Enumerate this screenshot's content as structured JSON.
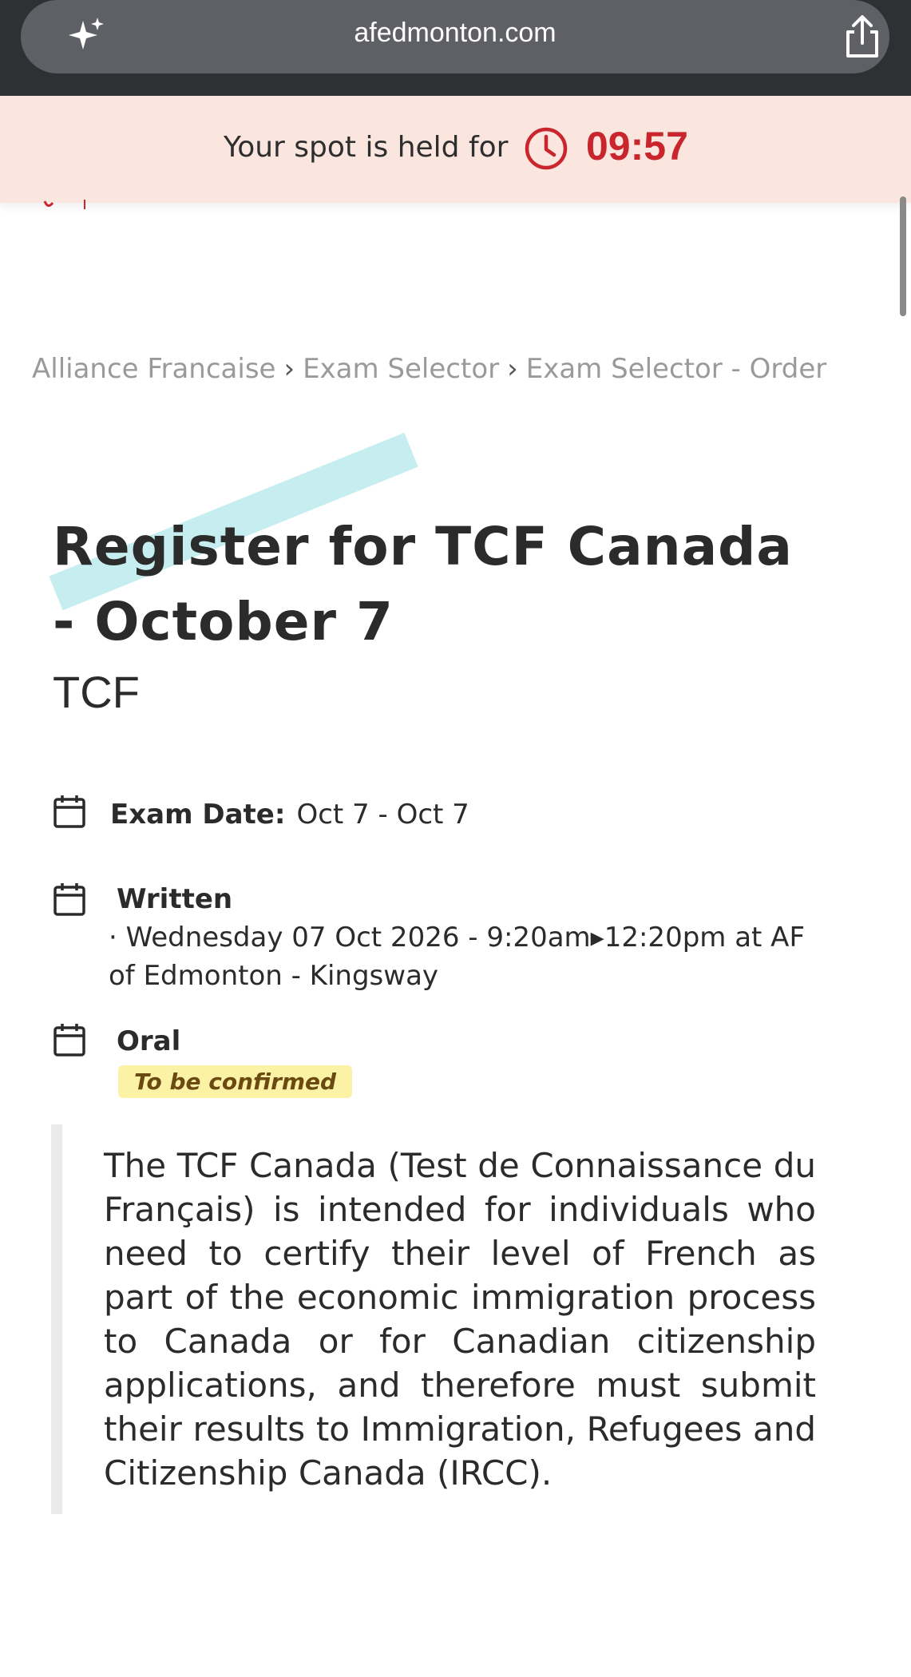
{
  "browser": {
    "url": "afedmonton.com",
    "left_icon": "sparkle-icon",
    "right_icon": "share-icon"
  },
  "hold_banner": {
    "text": "Your spot is held for",
    "timer": "09:57",
    "icon": "clock-icon",
    "accent_color": "#c8262c",
    "background_color": "#fbe6df"
  },
  "breadcrumb": {
    "items": [
      "Alliance Francaise",
      "Exam Selector",
      "Exam Selector - Order"
    ],
    "separator": "›"
  },
  "page": {
    "title": "Register for TCF Canada - October 7",
    "subtitle": "TCF"
  },
  "exam_info": {
    "exam_date_label": "Exam Date:",
    "exam_date_value": "Oct 7 - Oct 7",
    "written_label": "Written",
    "written_detail": "· Wednesday 07 Oct 2026 - 9:20am▸12:20pm at AF of Edmonton - Kingsway",
    "oral_label": "Oral",
    "oral_status": "To be confirmed",
    "icon": "calendar-icon"
  },
  "description": "The TCF Canada (Test de Connaissance du Français) is intended for individuals who need to certify their level of French as part of the economic immigration process to Canada or for Canadian citizenship applications, and therefore must submit their results to Immigration, Refugees and Citizenship Canada (IRCC)."
}
